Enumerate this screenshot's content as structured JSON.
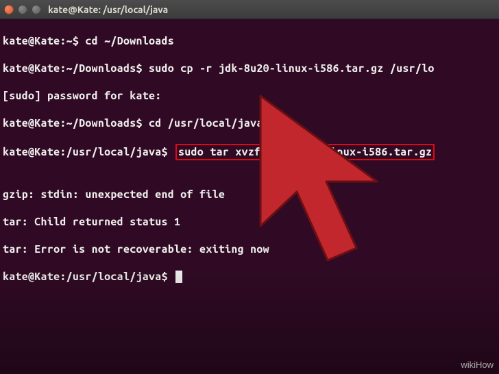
{
  "window": {
    "title": "kate@Kate: /usr/local/java"
  },
  "lines": {
    "l1_prompt": "kate@Kate:~$ ",
    "l1_cmd": "cd ~/Downloads",
    "l2_prompt": "kate@Kate:~/Downloads$ ",
    "l2_cmd": "sudo cp -r jdk-8u20-linux-i586.tar.gz /usr/lo",
    "l3": "[sudo] password for kate:",
    "l4_prompt": "kate@Kate:~/Downloads$ ",
    "l4_cmd": "cd /usr/local/java",
    "l5_prompt": "kate@Kate:/usr/local/java$",
    "l5_hl": "sudo tar xvzf jdk-8u20-linux-i586.tar.gz",
    "l6": "",
    "l7": "gzip: stdin: unexpected end of file",
    "l8": "tar: Child returned status 1",
    "l9": "tar: Error is not recoverable: exiting now",
    "l10_prompt": "kate@Kate:/usr/local/java$ "
  },
  "watermark": "wikiHow"
}
